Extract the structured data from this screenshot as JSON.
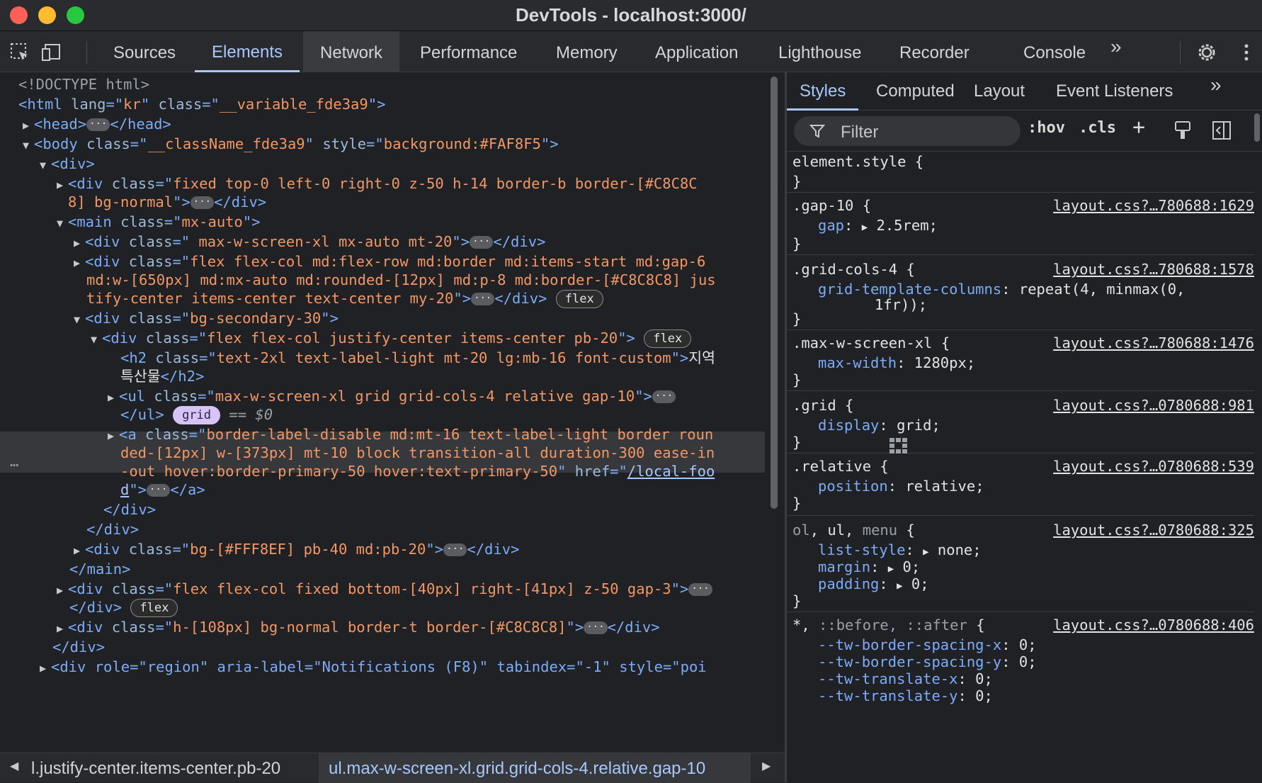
{
  "window": {
    "title": "DevTools - localhost:3000/"
  },
  "toolbar": {
    "tabs": [
      "Sources",
      "Elements",
      "Network",
      "Performance",
      "Memory",
      "Application",
      "Lighthouse",
      "Recorder",
      "Console"
    ],
    "active_tab": "Elements",
    "hovered_tab": "Network",
    "more": "»"
  },
  "dom": {
    "doctype": "<!DOCTYPE html>",
    "html_open": [
      "<html ",
      "lang",
      "=\"",
      "kr",
      "\" ",
      "class",
      "=\"",
      "__variable_fde3a9",
      "\">"
    ],
    "head": {
      "open": "<head>",
      "close": "</head>"
    },
    "body_tag": "<body ",
    "body_class": "__className_fde3a9",
    "body_style": "background:#FAF8F5",
    "div_open": "<div>",
    "fixed_div_class_1": "fixed top-0 left-0 right-0 z-50 h-14 border-b border-[#C8C8C",
    "fixed_div_class_2": "8] bg-normal",
    "main_class": "mx-auto",
    "div_maxw_class": " max-w-screen-xl mx-auto mt-20",
    "flex_div_class_1": "flex flex-col md:flex-row md:border md:items-start md:gap-6",
    "flex_div_class_2": "md:w-[650px] md:mx-auto md:rounded-[12px] md:p-8 md:border-[#C8C8C8] jus",
    "flex_div_class_3": "tify-center items-center text-center my-20",
    "bg_secondary_class": "bg-secondary-30",
    "flex_col_class": "flex flex-col justify-center items-center pb-20",
    "h2_class": "text-2xl text-label-light mt-20 lg:mb-16 font-custom",
    "h2_text_1": "지역",
    "h2_text_2": "특산물",
    "ul_class": "max-w-screen-xl grid grid-cols-4 relative gap-10",
    "selected_marker": "== $0",
    "a_class_1": "border-label-disable md:mt-16 text-label-light border roun",
    "a_class_2": "ded-[12px] w-[373px] mt-10 block transition-all duration-300 ease-in",
    "a_class_3": "-out hover:border-primary-50 hover:text-primary-50",
    "a_href_1": "/local-foo",
    "a_href_2": "d",
    "bg_fff_class": "bg-[#FFF8EF] pb-40 md:pb-20",
    "fixed_bottom_class": "flex flex-col fixed bottom-[40px] right-[41px] z-50 gap-3",
    "footer_class": "h-[108px] bg-normal border-t border-[#C8C8C8]",
    "region_line": "<div role=\"region\" aria-label=\"Notifications (F8)\" tabindex=\"-1\" style=\"poi",
    "badge_flex": "flex",
    "badge_grid": "grid"
  },
  "breadcrumbs": {
    "left": "l.justify-center.items-center.pb-20",
    "active": "ul.max-w-screen-xl.grid.grid-cols-4.relative.gap-10"
  },
  "styles_panel": {
    "tabs": [
      "Styles",
      "Computed",
      "Layout",
      "Event Listeners"
    ],
    "active_tab": "Styles",
    "filter_placeholder": "Filter",
    "hov": ":hov",
    "cls": ".cls",
    "rules": [
      {
        "selector": "element.style",
        "source": "",
        "props": []
      },
      {
        "selector": ".gap-10",
        "source": "layout.css?…780688:1629",
        "props": [
          {
            "name": "gap",
            "value": "2.5rem",
            "expand": true
          }
        ]
      },
      {
        "selector": ".grid-cols-4",
        "source": "layout.css?…780688:1578",
        "props": [
          {
            "name": "grid-template-columns",
            "value": "repeat(4, minmax(0,",
            "cont": "1fr));"
          }
        ]
      },
      {
        "selector": ".max-w-screen-xl",
        "source": "layout.css?…780688:1476",
        "props": [
          {
            "name": "max-width",
            "value": "1280px"
          }
        ]
      },
      {
        "selector": ".grid",
        "source": "layout.css?…0780688:981",
        "props": [
          {
            "name": "display",
            "value": "grid"
          }
        ]
      },
      {
        "selector": ".relative",
        "source": "layout.css?…0780688:539",
        "props": [
          {
            "name": "position",
            "value": "relative"
          }
        ]
      },
      {
        "selector": "ol, ul, menu",
        "source": "layout.css?…0780688:325",
        "props": [
          {
            "name": "list-style",
            "value": "none",
            "expand": true
          },
          {
            "name": "margin",
            "value": "0",
            "expand": true
          },
          {
            "name": "padding",
            "value": "0",
            "expand": true
          }
        ]
      },
      {
        "selector": "*, ::before, ::after",
        "source": "layout.css?…0780688:406",
        "props": [
          {
            "name": "--tw-border-spacing-x",
            "value": "0"
          },
          {
            "name": "--tw-border-spacing-y",
            "value": "0"
          },
          {
            "name": "--tw-translate-x",
            "value": "0"
          },
          {
            "name": "--tw-translate-y",
            "value": "0"
          }
        ]
      }
    ]
  }
}
